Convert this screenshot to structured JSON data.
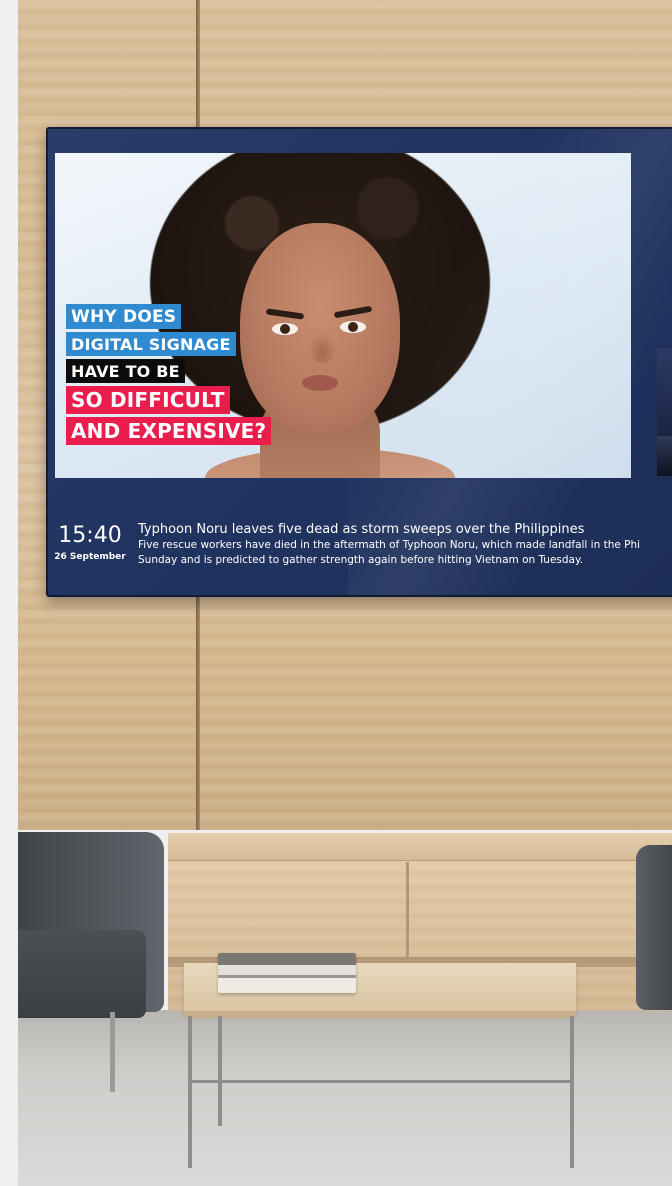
{
  "signage": {
    "headline_lines": [
      "WHY DOES",
      "DIGITAL SIGNAGE",
      "HAVE TO BE",
      "SO DIFFICULT",
      "AND EXPENSIVE?"
    ],
    "clock": {
      "time": "15:40",
      "date": "26 September"
    },
    "news": {
      "title": "Typhoon Noru leaves five dead as storm sweeps over the Philippines",
      "body_line_1": "Five rescue workers have died in the aftermath of Typhoon Noru, which made landfall in the Phi",
      "body_line_2": "Sunday and is predicted to gather strength again before hitting Vietnam on Tuesday."
    }
  },
  "colors": {
    "tv_panel": "#213461",
    "tag_blue": "#2f8ad0",
    "tag_black": "#0c0c0c",
    "tag_red": "#ea1d4c"
  }
}
